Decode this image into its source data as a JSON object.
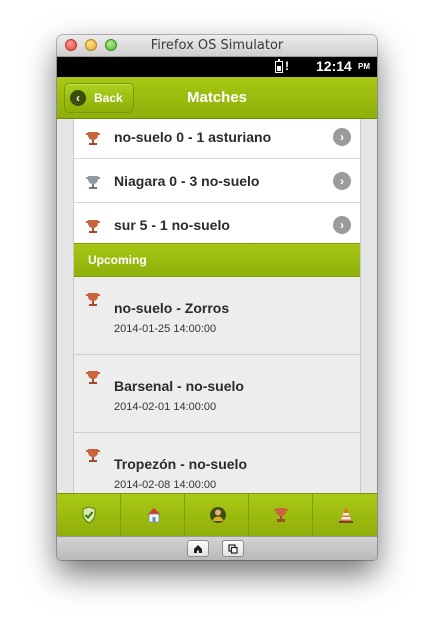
{
  "window": {
    "title": "Firefox OS Simulator"
  },
  "statusbar": {
    "clock": "12:14",
    "ampm": "PM",
    "battery_warning": "!"
  },
  "header": {
    "back_label": "Back",
    "back_icon": "chevron-left-icon",
    "title": "Matches"
  },
  "played_matches": [
    {
      "label": "no-suelo 0 - 1 asturiano",
      "trophy": "bronze"
    },
    {
      "label": "Niagara 0 - 3 no-suelo",
      "trophy": "silver"
    },
    {
      "label": "sur 5 - 1 no-suelo",
      "trophy": "bronze"
    }
  ],
  "upcoming": {
    "heading": "Upcoming",
    "matches": [
      {
        "label": "no-suelo - Zorros",
        "date": "2014-01-25 14:00:00"
      },
      {
        "label": "Barsenal - no-suelo",
        "date": "2014-02-01 14:00:00"
      },
      {
        "label": "Tropezón - no-suelo",
        "date": "2014-02-08 14:00:00"
      }
    ]
  },
  "tabbar": [
    {
      "icon": "shield-check-icon"
    },
    {
      "icon": "home-icon"
    },
    {
      "icon": "player-icon"
    },
    {
      "icon": "trophy-icon"
    },
    {
      "icon": "cone-icon"
    }
  ],
  "simulator_controls": [
    {
      "icon": "home-icon"
    },
    {
      "icon": "rotate-screen-icon"
    }
  ],
  "colors": {
    "accent": "#98b90f",
    "trophy_bronze": "#c9643e",
    "trophy_silver": "#8e9aa0",
    "arrow": "#9b9b9b"
  }
}
